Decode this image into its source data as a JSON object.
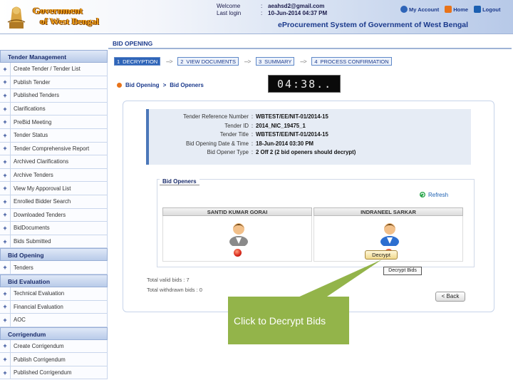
{
  "header": {
    "logo_line1": "Government",
    "logo_line2": "of West Bengal",
    "welcome_label": "Welcome",
    "welcome_value": "aeahsd2@gmail.com",
    "last_login_label": "Last login",
    "last_login_value": "10-Jun-2014 04:37 PM",
    "my_account": "My Account",
    "home": "Home",
    "logout": "Logout",
    "system_title": "eProcurement System of Government of West Bengal"
  },
  "page_tab": "BID OPENING",
  "sidebar": {
    "sections": [
      {
        "title": "Tender Management",
        "items": [
          "Create Tender / Tender List",
          "Publish Tender",
          "Published Tenders",
          "Clarifications",
          "PreBid Meeting",
          "Tender Status",
          "Tender Comprehensive Report",
          "Archived Clarifications",
          "Archive Tenders",
          "View My Apporoval List",
          "Enrolled Bidder Search",
          "Downloaded Tenders",
          "BidDocuments",
          "Bids Submitted"
        ]
      },
      {
        "title": "Bid Opening",
        "items": [
          "Tenders"
        ]
      },
      {
        "title": "Bid Evaluation",
        "items": [
          "Technical Evaluation",
          "Financial Evaluation",
          "AOC"
        ]
      },
      {
        "title": "Corrigendum",
        "items": [
          "Create Corrigendum",
          "Publish Corrigendum",
          "Published Corrigendum"
        ]
      }
    ]
  },
  "steps": [
    {
      "num": "1",
      "label": "DECRYPTION",
      "active": true
    },
    {
      "num": "2",
      "label": "VIEW DOCUMENTS",
      "active": false
    },
    {
      "num": "3",
      "label": "SUMMARY",
      "active": false
    },
    {
      "num": "4",
      "label": "PROCESS CONFIRMATION",
      "active": false
    }
  ],
  "arrow_glyph": "--->",
  "timer": "04:38..",
  "breadcrumb": {
    "item1": "Bid Opening",
    "sep": ">",
    "item2": "Bid Openers"
  },
  "details": {
    "rows": [
      {
        "label": "Tender Reference Number",
        "value": "WBTEST/EE/NIT-01/2014-15"
      },
      {
        "label": "Tender ID",
        "value": "2014_NIC_19475_1"
      },
      {
        "label": "Tender Title",
        "value": "WBTEST/EE/NIT-01/2014-15"
      },
      {
        "label": "Bid Opening Date & Time",
        "value": "18-Jun-2014 03:30 PM"
      },
      {
        "label": "Bid Opener Type",
        "value": "2 Off 2 (2 bid openers should decrypt)"
      }
    ]
  },
  "bid_openers": {
    "title": "Bid Openers",
    "refresh": "Refresh",
    "openers": [
      {
        "name": "SANTID KUMAR GORAI",
        "shirt_color": "#8a8a8a"
      },
      {
        "name": "INDRANEEL SARKAR",
        "shirt_color": "#2d6fd0"
      }
    ],
    "decrypt_button": "Decrypt",
    "tooltip": "Decrypt Bids"
  },
  "totals": {
    "valid_label": "Total valid bids : 7",
    "withdrawn_label": "Total withdrawn bids : 0"
  },
  "back_button": "< Back",
  "callout": "Click  to Decrypt Bids",
  "colors": {
    "accent": "#1b3a8c",
    "callout": "#93b44a",
    "status_red": "#d8261a"
  }
}
